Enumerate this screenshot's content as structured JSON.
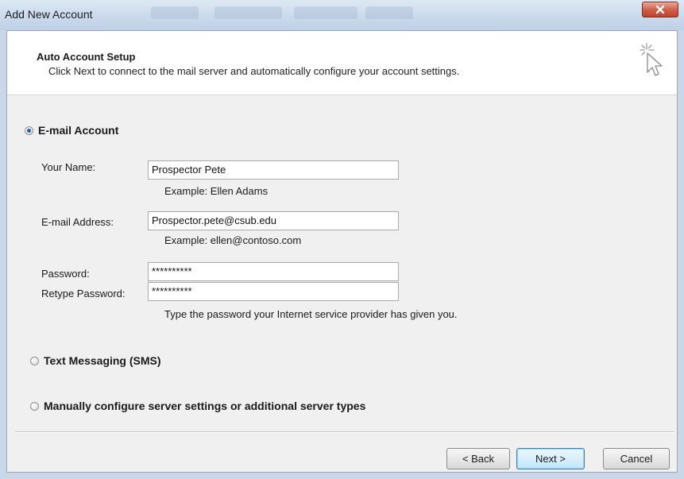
{
  "window": {
    "title": "Add New Account"
  },
  "header": {
    "title": "Auto Account Setup",
    "subtitle": "Click Next to connect to the mail server and automatically configure your account settings.",
    "icon": "cursor-sparkle-icon"
  },
  "options": {
    "email_account": {
      "label": "E-mail Account",
      "selected": true
    },
    "text_messaging": {
      "label": "Text Messaging (SMS)",
      "selected": false
    },
    "manual_config": {
      "label": "Manually configure server settings or additional server types",
      "selected": false
    }
  },
  "form": {
    "name_label": "Your Name:",
    "name_value": "Prospector Pete",
    "name_example": "Example: Ellen Adams",
    "email_label": "E-mail Address:",
    "email_value": "Prospector.pete@csub.edu",
    "email_example": "Example: ellen@contoso.com",
    "password_label": "Password:",
    "password_value": "**********",
    "retype_label": "Retype Password:",
    "retype_value": "**********",
    "password_hint": "Type the password your Internet service provider has given you."
  },
  "buttons": {
    "back": "< Back",
    "next": "Next >",
    "cancel": "Cancel"
  },
  "colors": {
    "close_button": "#d0614b",
    "radio_selected": "#1f5fae",
    "default_button_border": "#3c7fb1"
  }
}
